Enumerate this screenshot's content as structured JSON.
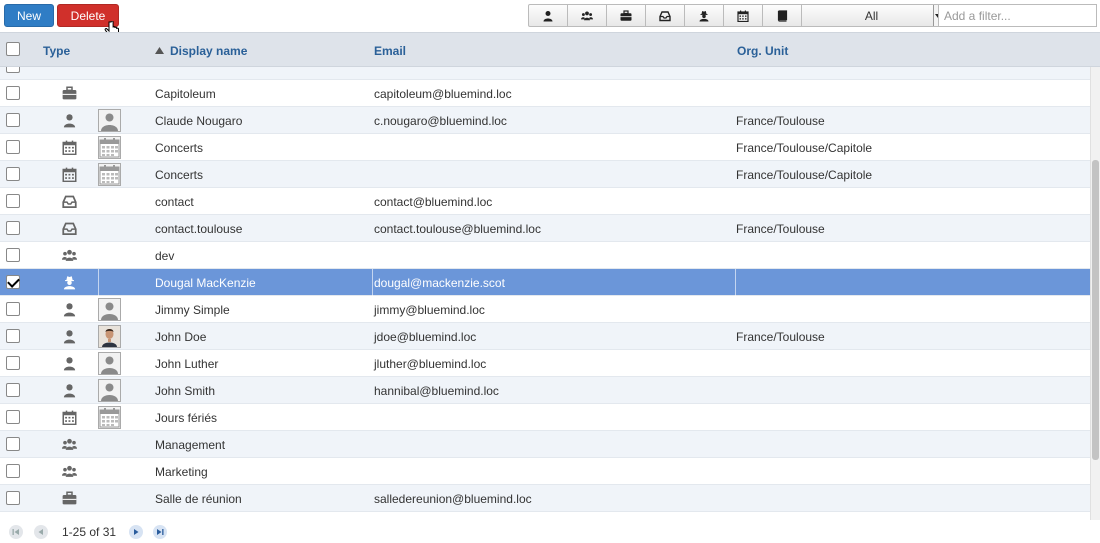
{
  "toolbar": {
    "new_label": "New",
    "delete_label": "Delete",
    "filter_icons": [
      "user-icon",
      "group-icon",
      "briefcase-icon",
      "inbox-icon",
      "user-secret-icon",
      "calendar-icon",
      "book-icon"
    ],
    "type_select_value": "All",
    "filter_placeholder": "Add a filter..."
  },
  "columns": {
    "type": "Type",
    "display_name": "Display name",
    "email": "Email",
    "org_unit": "Org. Unit"
  },
  "rows": [
    {
      "icon": "briefcase-icon",
      "thumb": "",
      "name": "Capitoleum",
      "email": "capitoleum@bluemind.loc",
      "org": "",
      "checked": false,
      "selected": false
    },
    {
      "icon": "user-icon",
      "thumb": "user",
      "name": "Claude Nougaro",
      "email": "c.nougaro@bluemind.loc",
      "org": "France/Toulouse",
      "checked": false,
      "selected": false
    },
    {
      "icon": "calendar-icon",
      "thumb": "calendar",
      "name": "Concerts",
      "email": "",
      "org": "France/Toulouse/Capitole",
      "checked": false,
      "selected": false
    },
    {
      "icon": "calendar-icon",
      "thumb": "calendar",
      "name": "Concerts",
      "email": "",
      "org": "France/Toulouse/Capitole",
      "checked": false,
      "selected": false
    },
    {
      "icon": "inbox-icon",
      "thumb": "",
      "name": "contact",
      "email": "contact@bluemind.loc",
      "org": "",
      "checked": false,
      "selected": false
    },
    {
      "icon": "inbox-icon",
      "thumb": "",
      "name": "contact.toulouse",
      "email": "contact.toulouse@bluemind.loc",
      "org": "France/Toulouse",
      "checked": false,
      "selected": false
    },
    {
      "icon": "group-icon",
      "thumb": "",
      "name": "dev",
      "email": "",
      "org": "",
      "checked": false,
      "selected": false
    },
    {
      "icon": "user-secret-icon",
      "thumb": "",
      "name": "Dougal MacKenzie",
      "email": "dougal@mackenzie.scot",
      "org": "",
      "checked": true,
      "selected": true
    },
    {
      "icon": "user-icon",
      "thumb": "user",
      "name": "Jimmy Simple",
      "email": "jimmy@bluemind.loc",
      "org": "",
      "checked": false,
      "selected": false
    },
    {
      "icon": "user-icon",
      "thumb": "photo",
      "name": "John Doe",
      "email": "jdoe@bluemind.loc",
      "org": "France/Toulouse",
      "checked": false,
      "selected": false
    },
    {
      "icon": "user-icon",
      "thumb": "user",
      "name": "John Luther",
      "email": "jluther@bluemind.loc",
      "org": "",
      "checked": false,
      "selected": false
    },
    {
      "icon": "user-icon",
      "thumb": "user",
      "name": "John Smith",
      "email": "hannibal@bluemind.loc",
      "org": "",
      "checked": false,
      "selected": false
    },
    {
      "icon": "calendar-icon",
      "thumb": "calendar",
      "name": "Jours fériés",
      "email": "",
      "org": "",
      "checked": false,
      "selected": false
    },
    {
      "icon": "group-icon",
      "thumb": "",
      "name": "Management",
      "email": "",
      "org": "",
      "checked": false,
      "selected": false
    },
    {
      "icon": "group-icon",
      "thumb": "",
      "name": "Marketing",
      "email": "",
      "org": "",
      "checked": false,
      "selected": false
    },
    {
      "icon": "briefcase-icon",
      "thumb": "",
      "name": "Salle de réunion",
      "email": "salledereunion@bluemind.loc",
      "org": "",
      "checked": false,
      "selected": false
    }
  ],
  "pager": {
    "label": "1-25 of 31"
  },
  "colors": {
    "new": "#2f7dc5",
    "delete": "#d0302b",
    "header_bg": "#dee3ea",
    "header_text": "#2a6098",
    "selected_row": "#6b96d9"
  }
}
